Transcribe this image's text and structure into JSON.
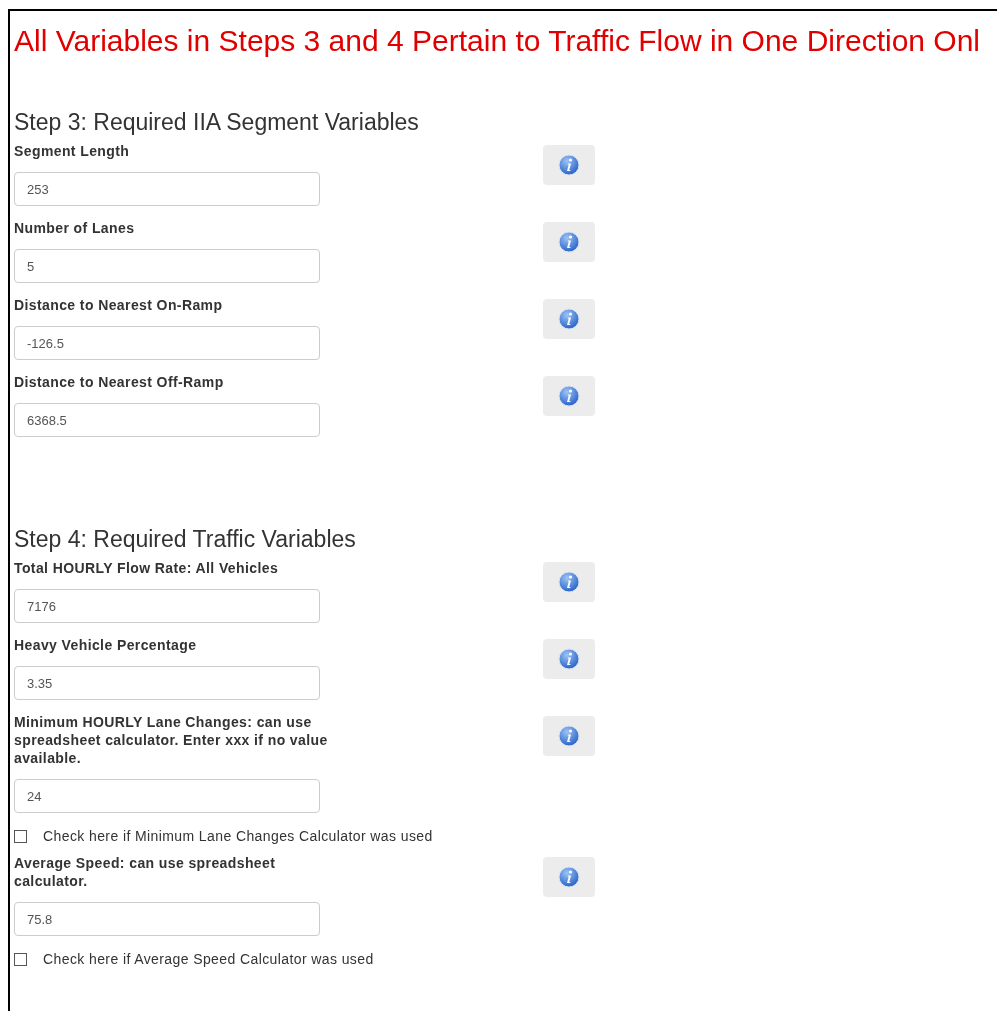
{
  "notice": "All Variables in Steps 3 and 4 Pertain to Traffic Flow in One Direction Onl",
  "sections": [
    {
      "title": "Step 3: Required IIA Segment Variables",
      "fields": [
        {
          "kind": "input",
          "label": "Segment Length",
          "value": "253",
          "info": true
        },
        {
          "kind": "input",
          "label": "Number of Lanes",
          "value": "5",
          "info": true
        },
        {
          "kind": "input",
          "label": "Distance to Nearest On-Ramp",
          "value": "-126.5",
          "info": true
        },
        {
          "kind": "input",
          "label": "Distance to Nearest Off-Ramp",
          "value": "6368.5",
          "info": true
        }
      ]
    },
    {
      "title": "Step 4: Required Traffic Variables",
      "fields": [
        {
          "kind": "input",
          "label": "Total HOURLY Flow Rate: All Vehicles",
          "value": "7176",
          "info": true
        },
        {
          "kind": "input",
          "label": "Heavy Vehicle Percentage",
          "value": "3.35",
          "info": true
        },
        {
          "kind": "input",
          "label": "Minimum HOURLY Lane Changes: can use spreadsheet calculator. Enter xxx if no value available.",
          "value": "24",
          "info": true
        },
        {
          "kind": "checkbox",
          "label": "Check here if Minimum Lane Changes Calculator was used",
          "checked": false
        },
        {
          "kind": "input",
          "label": "Average Speed: can use spreadsheet calculator.",
          "value": "75.8",
          "info": true
        },
        {
          "kind": "checkbox",
          "label": "Check here if Average Speed Calculator was used",
          "checked": false
        }
      ]
    }
  ]
}
